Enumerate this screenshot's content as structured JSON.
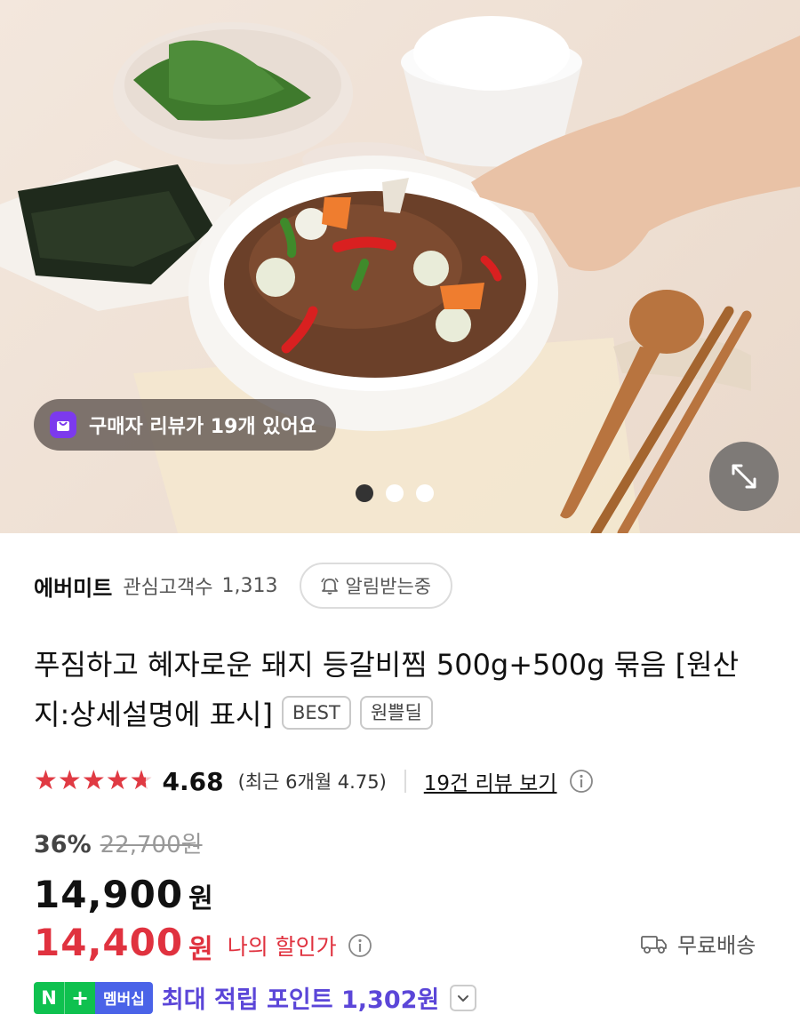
{
  "hero": {
    "review_pill": "구매자 리뷰가 19개 있어요",
    "slides_total": 3,
    "slide_active": 1
  },
  "seller": {
    "name": "에버미트",
    "fans_label": "관심고객수",
    "fans_count": "1,313",
    "notify_label": "알림받는중"
  },
  "product": {
    "title": "푸짐하고 혜자로운 돼지 등갈비찜 500g+500g 묶음 [원산지:상세설명에 표시]",
    "badges": [
      "BEST",
      "원쁠딜"
    ]
  },
  "rating": {
    "score": "4.68",
    "stars": 4.68,
    "recent": "(최근 6개월 4.75)",
    "review_link": "19건 리뷰 보기"
  },
  "price": {
    "discount_pct": "36%",
    "original": "22,700원",
    "sale": "14,900",
    "sale_unit": "원",
    "my_price": "14,400",
    "my_unit": "원",
    "my_label": "나의 할인가",
    "shipping": "무료배송"
  },
  "points": {
    "n_label": "N",
    "plus_label": "+",
    "membership_label": "멤버십",
    "text": "최대 적립 포인트 1,302원"
  },
  "colors": {
    "accent_red": "#e0323f",
    "points_purple": "#5b46d8",
    "naver_green": "#0fc14f"
  }
}
